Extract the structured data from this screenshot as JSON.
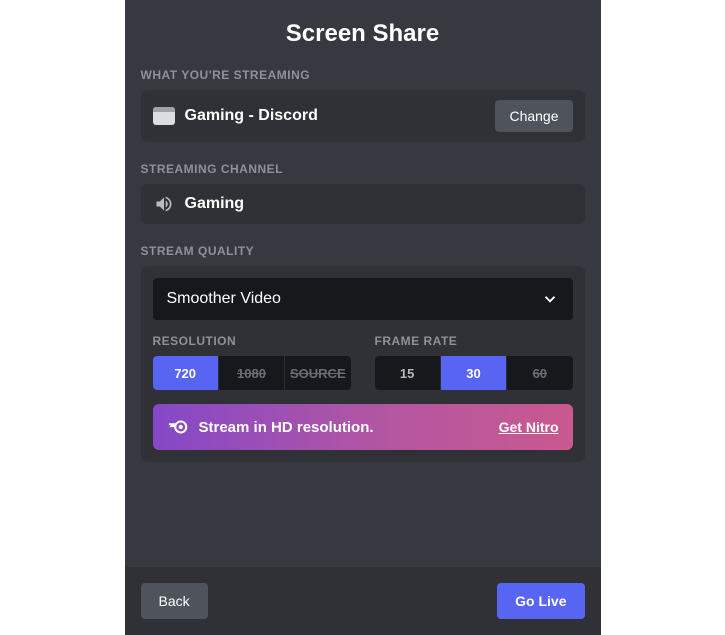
{
  "title": "Screen Share",
  "streaming": {
    "section_label": "WHAT YOU'RE STREAMING",
    "app_name": "Gaming - Discord",
    "change_label": "Change"
  },
  "channel": {
    "section_label": "STREAMING CHANNEL",
    "name": "Gaming"
  },
  "quality": {
    "section_label": "STREAM QUALITY",
    "preset_selected": "Smoother Video",
    "resolution": {
      "label": "RESOLUTION",
      "options": [
        {
          "label": "720",
          "active": true,
          "locked": false
        },
        {
          "label": "1080",
          "active": false,
          "locked": true
        },
        {
          "label": "SOURCE",
          "active": false,
          "locked": true
        }
      ]
    },
    "framerate": {
      "label": "FRAME RATE",
      "options": [
        {
          "label": "15",
          "active": false,
          "locked": false
        },
        {
          "label": "30",
          "active": true,
          "locked": false
        },
        {
          "label": "60",
          "active": false,
          "locked": true
        }
      ]
    }
  },
  "nitro": {
    "message": "Stream in HD resolution.",
    "cta": "Get Nitro"
  },
  "footer": {
    "back": "Back",
    "go_live": "Go Live"
  },
  "colors": {
    "accent": "#5865f2",
    "bg": "#36393f",
    "panel": "#2f3136"
  }
}
